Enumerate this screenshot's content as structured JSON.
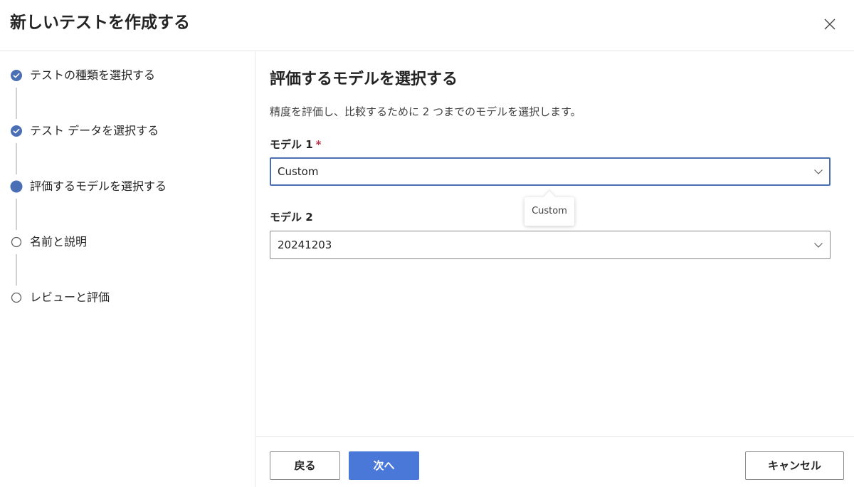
{
  "dialog": {
    "title": "新しいテストを作成する",
    "close_icon": "close-icon"
  },
  "steps": [
    {
      "label": "テストの種類を選択する",
      "state": "completed",
      "icon": "checkmark-circle-icon"
    },
    {
      "label": "テスト データを選択する",
      "state": "completed",
      "icon": "checkmark-circle-icon"
    },
    {
      "label": "評価するモデルを選択する",
      "state": "current",
      "icon": "filled-circle-icon"
    },
    {
      "label": "名前と説明",
      "state": "pending",
      "icon": "empty-circle-icon"
    },
    {
      "label": "レビューと評価",
      "state": "pending",
      "icon": "empty-circle-icon"
    }
  ],
  "main": {
    "title": "評価するモデルを選択する",
    "description": "精度を評価し、比較するために 2 つまでのモデルを選択します。",
    "model1": {
      "label": "モデル 1",
      "required_marker": "*",
      "value": "Custom"
    },
    "model2": {
      "label": "モデル 2",
      "value": "20241203"
    },
    "tooltip": "Custom"
  },
  "footer": {
    "back_label": "戻る",
    "next_label": "次へ",
    "cancel_label": "キャンセル"
  },
  "colors": {
    "accent": "#4a78d8",
    "step_active": "#4b6fb5",
    "required": "#c4314b",
    "divider": "#e6e6e6"
  }
}
